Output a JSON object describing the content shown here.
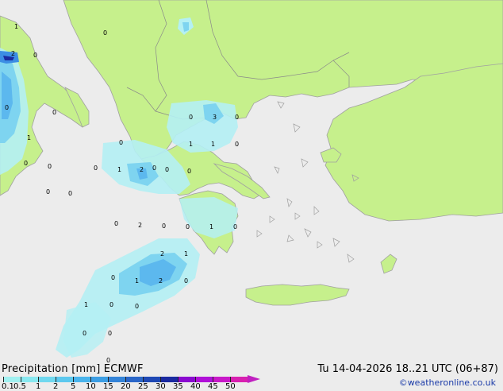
{
  "map": {
    "colors": {
      "sea": "#ececec",
      "land": "#c6f08c",
      "coast": "#a0a0a0",
      "border": "#8a8a8a"
    },
    "precip_values": [
      "1",
      "0",
      "2",
      "0",
      "0",
      "0",
      "1",
      "0",
      "0",
      "0",
      "0",
      "0",
      "2",
      "1",
      "0",
      "0",
      "0",
      "0",
      "1",
      "1",
      "0",
      "0",
      "3",
      "0",
      "0",
      "0",
      "2",
      "0",
      "0",
      "1",
      "0",
      "0",
      "2",
      "1",
      "0",
      "1",
      "2",
      "0",
      "1",
      "0",
      "0",
      "0",
      "0",
      "0"
    ]
  },
  "footer": {
    "title": "Precipitation [mm] ECMWF",
    "datetime": "Tu 14-04-2026 18..21 UTC (06+87)",
    "credit": "©weatheronline.co.uk",
    "scale_ticks": [
      "0.1",
      "0.5",
      "1",
      "2",
      "5",
      "10",
      "15",
      "20",
      "25",
      "30",
      "35",
      "40",
      "45",
      "50"
    ],
    "scale_colors": [
      "#a0f0f0",
      "#88e8f0",
      "#70d8ef",
      "#5cc8ee",
      "#4ab4ec",
      "#3c9ee4",
      "#3484d8",
      "#2a66c8",
      "#1e48b4",
      "#1a2aa0",
      "#8a0ad0",
      "#b010d8",
      "#c818c8",
      "#d820b0"
    ]
  }
}
